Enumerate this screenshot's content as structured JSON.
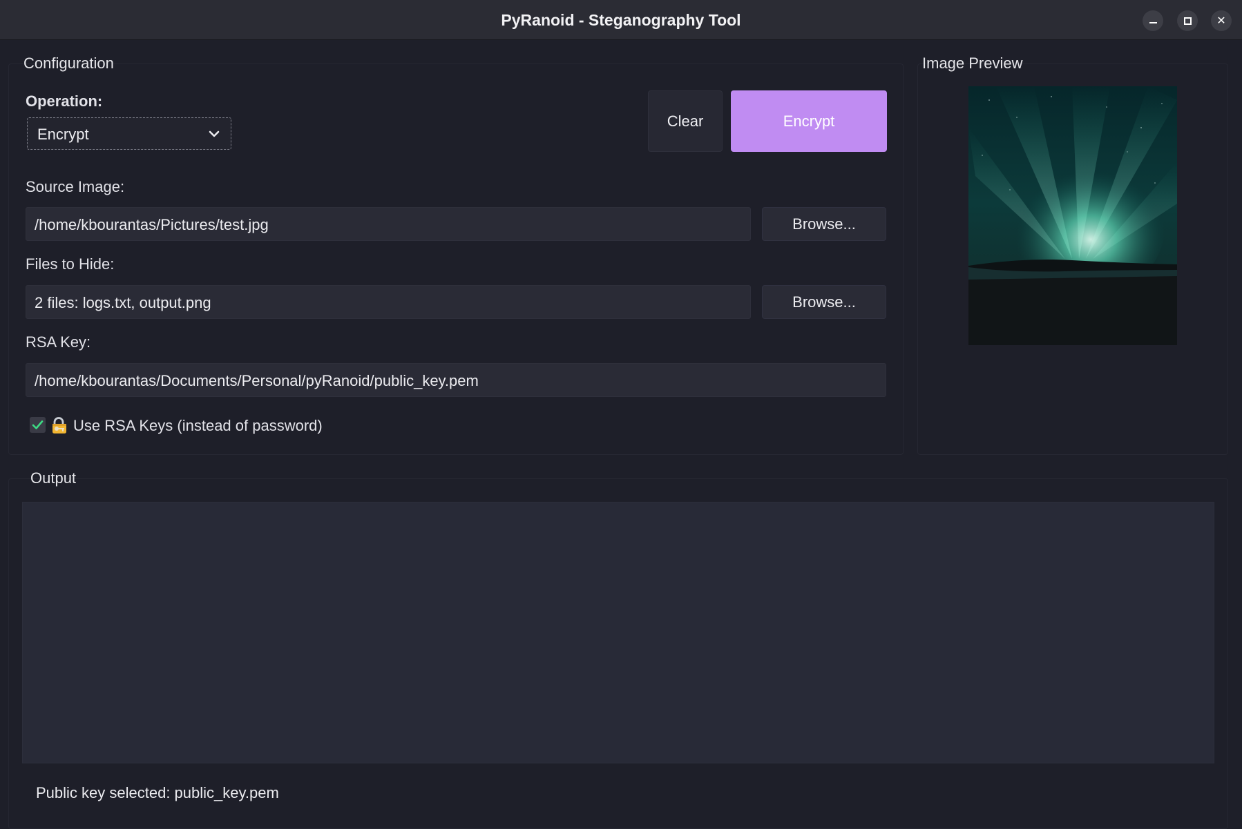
{
  "window": {
    "title": "PyRanoid - Steganography Tool",
    "minimize_glyph": "",
    "maximize_glyph": "",
    "close_glyph": "✕"
  },
  "configuration": {
    "title": "Configuration",
    "operation_label": "Operation:",
    "operation_value": "Encrypt",
    "clear_label": "Clear",
    "encrypt_label": "Encrypt",
    "source_image_label": "Source Image:",
    "source_image_value": "/home/kbourantas/Pictures/test.jpg",
    "browse_label": "Browse...",
    "files_label": "Files to Hide:",
    "files_value": "2 files: logs.txt, output.png",
    "rsa_label": "RSA Key:",
    "rsa_value": "/home/kbourantas/Documents/Personal/pyRanoid/public_key.pem",
    "use_rsa_label": "Use RSA Keys (instead of password)",
    "use_rsa_checked": true
  },
  "preview": {
    "title": "Image Preview"
  },
  "output": {
    "title": "Output",
    "log_text": "",
    "status": "Public key selected: public_key.pem"
  },
  "colors": {
    "accent": "#c08cf2",
    "background": "#1e1f29",
    "check": "#3ddc84"
  },
  "icons": {
    "dropdown": "chevron-down-icon",
    "lock": "locked-with-key-icon",
    "checkbox": "checkmark-icon"
  }
}
